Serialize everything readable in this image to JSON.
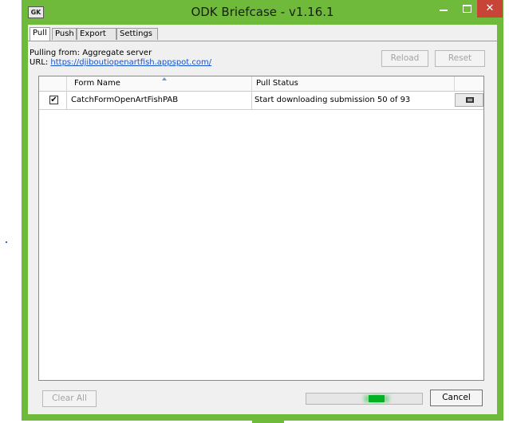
{
  "window": {
    "title": "ODK Briefcase - v1.16.1",
    "icon_text": "GK",
    "accent_color": "#6fba3a",
    "close_color": "#c74436"
  },
  "tabs": [
    {
      "label": "Pull",
      "active": true
    },
    {
      "label": "Push",
      "active": false
    },
    {
      "label": "Export",
      "active": false
    },
    {
      "label": "Settings",
      "active": false
    }
  ],
  "pull": {
    "source_text": "Pulling from: Aggregate server",
    "url_label": "URL:",
    "url": "https://djiboutiopenartfish.appspot.com/",
    "reload_label": "Reload",
    "reset_label": "Reset"
  },
  "table": {
    "columns": [
      "Form Name",
      "Pull Status"
    ],
    "rows": [
      {
        "checked": true,
        "form_name": "CatchFormOpenArtFishPAB",
        "status": "Start downloading submission 50 of 93"
      }
    ]
  },
  "footer": {
    "clear_all_label": "Clear All",
    "cancel_label": "Cancel",
    "progress_state": "indeterminate",
    "progress_color": "#06b025"
  }
}
